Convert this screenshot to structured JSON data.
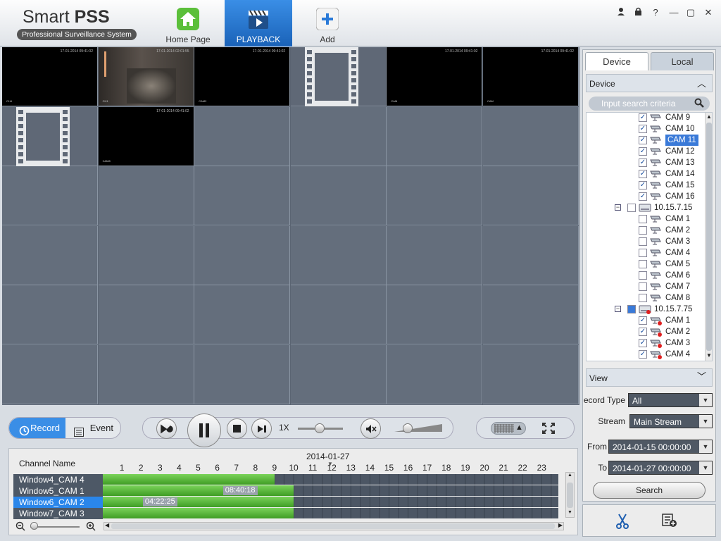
{
  "app": {
    "title": "Smart",
    "title_bold": "PSS",
    "subtitle": "Professional Surveillance System"
  },
  "nav": {
    "home": "Home Page",
    "playback": "PLAYBACK",
    "add": "Add"
  },
  "window_controls": [
    "user-icon",
    "lock-icon",
    "help-icon",
    "minimize-icon",
    "maximize-icon",
    "close-icon"
  ],
  "right_panel": {
    "tabs": [
      "Device",
      "Local"
    ],
    "device_header": "Device",
    "search_placeholder": "Input search criteria",
    "tree": [
      {
        "label": "CAM 9",
        "type": "cam",
        "checked": true,
        "indent": 2
      },
      {
        "label": "CAM 10",
        "type": "cam",
        "checked": true,
        "indent": 2
      },
      {
        "label": "CAM 11",
        "type": "cam",
        "checked": true,
        "indent": 2,
        "selected": true
      },
      {
        "label": "CAM 12",
        "type": "cam",
        "checked": true,
        "indent": 2
      },
      {
        "label": "CAM 13",
        "type": "cam",
        "checked": true,
        "indent": 2
      },
      {
        "label": "CAM 14",
        "type": "cam",
        "checked": true,
        "indent": 2
      },
      {
        "label": "CAM 15",
        "type": "cam",
        "checked": true,
        "indent": 2
      },
      {
        "label": "CAM 16",
        "type": "cam",
        "checked": true,
        "indent": 2
      },
      {
        "label": "10.15.7.15",
        "type": "device",
        "checked": false,
        "indent": 1
      },
      {
        "label": "CAM 1",
        "type": "cam",
        "checked": false,
        "indent": 2
      },
      {
        "label": "CAM 2",
        "type": "cam",
        "checked": false,
        "indent": 2
      },
      {
        "label": "CAM 3",
        "type": "cam",
        "checked": false,
        "indent": 2
      },
      {
        "label": "CAM 4",
        "type": "cam",
        "checked": false,
        "indent": 2
      },
      {
        "label": "CAM 5",
        "type": "cam",
        "checked": false,
        "indent": 2
      },
      {
        "label": "CAM 6",
        "type": "cam",
        "checked": false,
        "indent": 2
      },
      {
        "label": "CAM 7",
        "type": "cam",
        "checked": false,
        "indent": 2
      },
      {
        "label": "CAM 8",
        "type": "cam",
        "checked": false,
        "indent": 2
      },
      {
        "label": "10.15.7.75",
        "type": "device",
        "checked": "partial",
        "indent": 1,
        "offline": true
      },
      {
        "label": "CAM 1",
        "type": "cam",
        "checked": true,
        "indent": 2,
        "offline": true
      },
      {
        "label": "CAM 2",
        "type": "cam",
        "checked": true,
        "indent": 2,
        "offline": true
      },
      {
        "label": "CAM 3",
        "type": "cam",
        "checked": true,
        "indent": 2,
        "offline": true
      },
      {
        "label": "CAM 4",
        "type": "cam",
        "checked": true,
        "indent": 2,
        "offline": true
      },
      {
        "label": "",
        "type": "cam",
        "checked": true,
        "indent": 2,
        "offline": true
      }
    ],
    "view_header": "View",
    "record_type_label": "ecord Type",
    "record_type_value": "All",
    "stream_label": "Stream",
    "stream_value": "Main Stream",
    "from_label": "From",
    "from_value": "2014-01-15 00:00:00",
    "to_label": "To",
    "to_value": "2014-01-27 00:00:00",
    "search_label": "Search"
  },
  "video_cells": [
    {
      "kind": "black",
      "ts": "17-01-2014 09:41:02",
      "fl": "CH4"
    },
    {
      "kind": "cam",
      "ts": "17-01-2014 02:01:55",
      "fl": "CH1"
    },
    {
      "kind": "black",
      "ts": "17-01-2014 09:41:02",
      "fl": "CAM2"
    },
    {
      "kind": "film"
    },
    {
      "kind": "black",
      "ts": "17-01-2014 09:41:02",
      "fl": "CAM"
    },
    {
      "kind": "black",
      "ts": "17-01-2014 09:41:02",
      "fl": "CAM"
    },
    {
      "kind": "film"
    },
    {
      "kind": "black",
      "ts": "17-01-2014 09:41:02",
      "fl": "CAM8"
    }
  ],
  "controls": {
    "record": "Record",
    "event": "Event",
    "speed": "1X"
  },
  "timeline": {
    "date": "2014-01-27",
    "channel_header": "Channel Name",
    "hours": [
      "1",
      "2",
      "3",
      "4",
      "5",
      "6",
      "7",
      "8",
      "9",
      "10",
      "11",
      "12",
      "13",
      "14",
      "15",
      "16",
      "17",
      "18",
      "19",
      "20",
      "21",
      "22",
      "23"
    ],
    "channels": [
      {
        "name": "Window4_CAM 4",
        "end_hour": 9.0,
        "selected": false
      },
      {
        "name": "Window5_CAM 1",
        "end_hour": 10.0,
        "selected": false,
        "marker": "08:40:18",
        "marker_hour": 6.3
      },
      {
        "name": "Window6_CAM 2",
        "end_hour": 10.0,
        "selected": true,
        "marker": "04:22:25",
        "marker_hour": 2.1
      },
      {
        "name": "Window7_CAM 3",
        "end_hour": 10.0,
        "selected": false
      }
    ]
  }
}
